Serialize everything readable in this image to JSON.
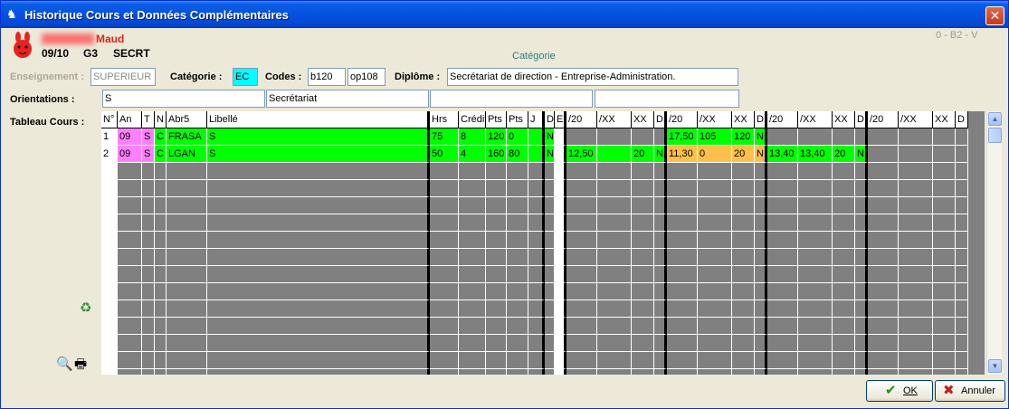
{
  "window": {
    "title": "Historique Cours et Données Complémentaires",
    "close_label": "✕"
  },
  "header": {
    "name": "Maud",
    "year": "09/10",
    "group": "G3",
    "section": "SECRT",
    "categorie_title": "Catégorie",
    "code_top_right": "0 - B2  - V"
  },
  "form": {
    "enseignement_label": "Enseignement :",
    "enseignement_value": "SUPERIEUR",
    "categorie_label": "Catégorie :",
    "categorie_value": "EC",
    "codes_label": "Codes :",
    "code1": "b120",
    "code2": "op108",
    "diplome_label": "Diplôme :",
    "diplome_value": "Secrétariat de direction - Entreprise-Administration.",
    "orientations_label": "Orientations :",
    "orient1": "S",
    "orient2": "Secrétariat",
    "orient3": "",
    "orient4": "",
    "tableau_label": "Tableau Cours :"
  },
  "table": {
    "headers": [
      "N°",
      "An",
      "T",
      "N",
      "Abr5",
      "Libellé",
      "Hrs",
      "Crédit",
      "Pts",
      "Pts",
      "J",
      "D",
      "E",
      "/20",
      "/XX",
      "XX",
      "D",
      "/20",
      "/XX",
      "XX",
      "D",
      "/20",
      "/XX",
      "XX",
      "D",
      "/20",
      "/XX",
      "XX",
      "D"
    ],
    "rows": [
      [
        "1",
        "09",
        "S",
        "C",
        "FRASA",
        "S",
        "75",
        "8",
        "120",
        "0",
        "",
        "N",
        "",
        "",
        "",
        "",
        "",
        "17,50",
        "105",
        "120",
        "N",
        "",
        "",
        "",
        "",
        "",
        "",
        "",
        ""
      ],
      [
        "2",
        "09",
        "S",
        "C",
        "LGAN",
        "S",
        "50",
        "4",
        "160",
        "80",
        "",
        "N",
        "",
        "12,50",
        "",
        "20",
        "N",
        "11,30",
        "0",
        "20",
        "N",
        "13,40",
        "13,40",
        "20",
        "N",
        "",
        "",
        "",
        ""
      ]
    ],
    "colors": {
      "green": "#00ff00",
      "pink": "#ff80ff",
      "orange": "#ffc04b",
      "gray": "#808080",
      "white": "#ffffff"
    }
  },
  "buttons": {
    "ok_label": "OK",
    "cancel_label": "Annuler"
  },
  "icons": {
    "recycle": "recycle-icon",
    "preview": "print-preview-icon",
    "print": "printer-icon"
  }
}
